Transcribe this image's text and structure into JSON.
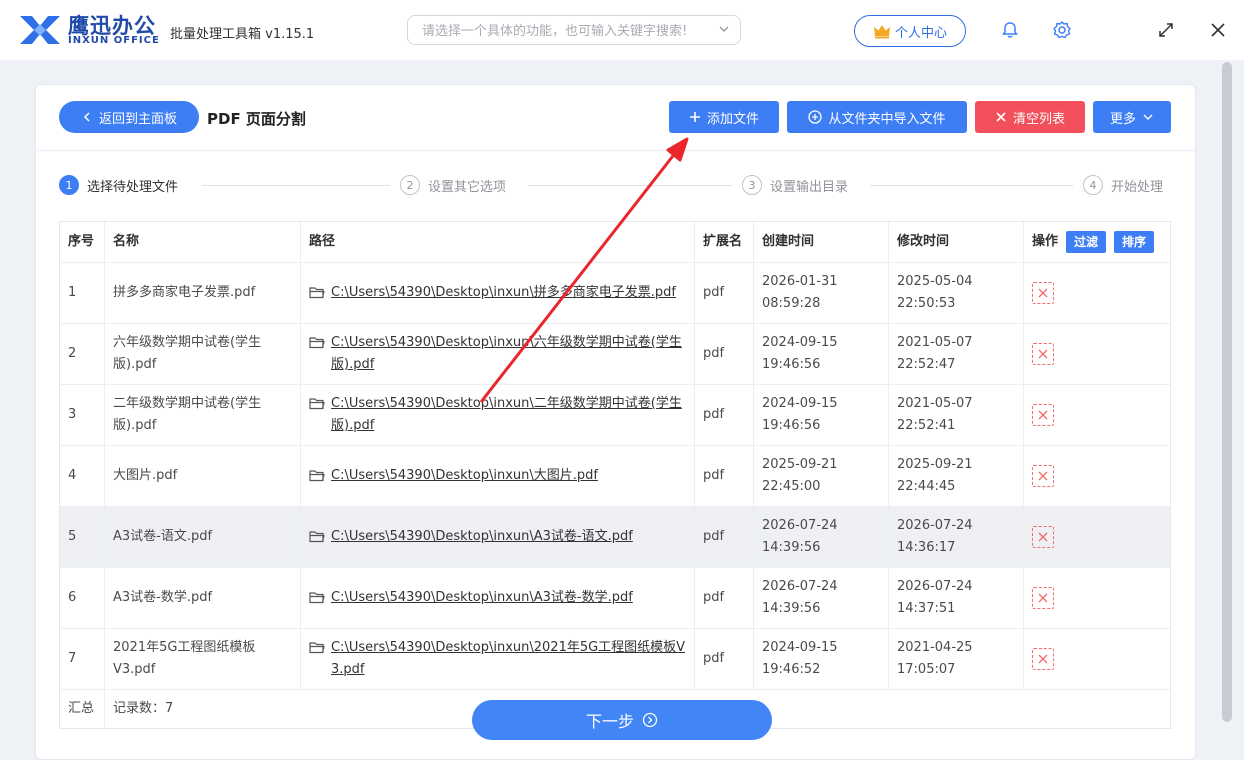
{
  "app": {
    "logo_cn": "鹰迅办公",
    "logo_en": "INXUN OFFICE",
    "title": "批量处理工具箱 v1.15.1",
    "search_placeholder": "请选择一个具体的功能，也可输入关键字搜索!",
    "user_center": "个人中心"
  },
  "toolbar": {
    "back": "返回到主面板",
    "page_title": "PDF 页面分割",
    "add_file": "添加文件",
    "import_folder": "从文件夹中导入文件",
    "clear_list": "清空列表",
    "more": "更多"
  },
  "steps": [
    {
      "num": "1",
      "label": "选择待处理文件"
    },
    {
      "num": "2",
      "label": "设置其它选项"
    },
    {
      "num": "3",
      "label": "设置输出目录"
    },
    {
      "num": "4",
      "label": "开始处理"
    }
  ],
  "table": {
    "headers": {
      "index": "序号",
      "name": "名称",
      "path": "路径",
      "ext": "扩展名",
      "created": "创建时间",
      "modified": "修改时间",
      "ops": "操作",
      "filter": "过滤",
      "sort": "排序"
    },
    "rows": [
      {
        "index": "1",
        "name": "拼多多商家电子发票.pdf",
        "path": "C:\\Users\\54390\\Desktop\\inxun\\拼多多商家电子发票.pdf",
        "ext": "pdf",
        "created": "2026-01-31 08:59:28",
        "modified": "2025-05-04 22:50:53"
      },
      {
        "index": "2",
        "name": "六年级数学期中试卷(学生版).pdf",
        "path": "C:\\Users\\54390\\Desktop\\inxun\\六年级数学期中试卷(学生版).pdf",
        "ext": "pdf",
        "created": "2024-09-15 19:46:56",
        "modified": "2021-05-07 22:52:47"
      },
      {
        "index": "3",
        "name": "二年级数学期中试卷(学生版).pdf",
        "path": "C:\\Users\\54390\\Desktop\\inxun\\二年级数学期中试卷(学生版).pdf",
        "ext": "pdf",
        "created": "2024-09-15 19:46:56",
        "modified": "2021-05-07 22:52:41"
      },
      {
        "index": "4",
        "name": "大图片.pdf",
        "path": "C:\\Users\\54390\\Desktop\\inxun\\大图片.pdf",
        "ext": "pdf",
        "created": "2025-09-21 22:45:00",
        "modified": "2025-09-21 22:44:45"
      },
      {
        "index": "5",
        "name": "A3试卷-语文.pdf",
        "path": "C:\\Users\\54390\\Desktop\\inxun\\A3试卷-语文.pdf",
        "ext": "pdf",
        "created": "2026-07-24 14:39:56",
        "modified": "2026-07-24 14:36:17"
      },
      {
        "index": "6",
        "name": "A3试卷-数学.pdf",
        "path": "C:\\Users\\54390\\Desktop\\inxun\\A3试卷-数学.pdf",
        "ext": "pdf",
        "created": "2026-07-24 14:39:56",
        "modified": "2026-07-24 14:37:51"
      },
      {
        "index": "7",
        "name": "2021年5G工程图纸模板V3.pdf",
        "path": "C:\\Users\\54390\\Desktop\\inxun\\2021年5G工程图纸模板V3.pdf",
        "ext": "pdf",
        "created": "2024-09-15 19:46:52",
        "modified": "2021-04-25 17:05:07"
      }
    ],
    "summary_label": "汇总",
    "record_count": "记录数：7"
  },
  "next_button": "下一步",
  "icons": {
    "back": "chevron-left-icon",
    "add": "plus-icon",
    "import": "circle-plus-icon",
    "clear": "close-icon",
    "more": "chevron-down-icon",
    "folder": "folder-icon",
    "delete": "delete-x-icon",
    "next": "circle-arrow-right-icon",
    "crown": "crown-icon",
    "bell": "bell-icon",
    "settings": "gear-icon",
    "maximize": "maximize-icon",
    "close": "close-window-icon"
  },
  "colors": {
    "primary": "#3d7ef5",
    "danger": "#f1505a",
    "arrow": "#e8262c"
  }
}
